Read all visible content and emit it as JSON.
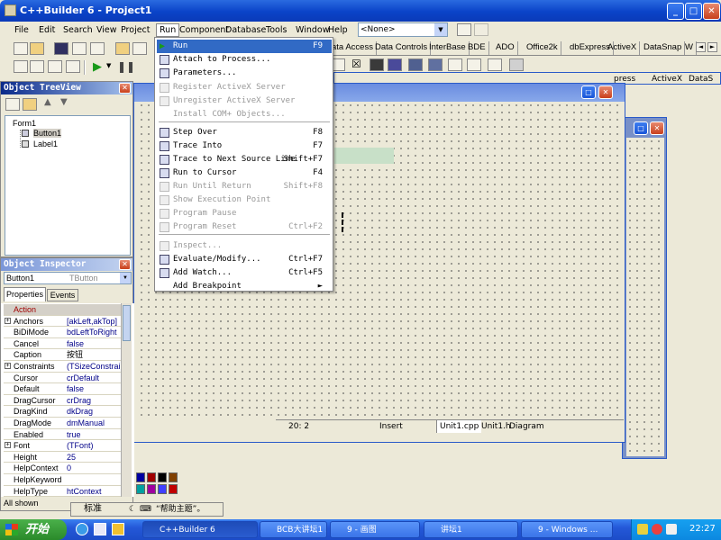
{
  "app": {
    "title": "C++Builder 6 - Project1"
  },
  "menu": [
    "File",
    "Edit",
    "Search",
    "View",
    "Project",
    "Run",
    "Component",
    "Database",
    "Tools",
    "Window",
    "Help"
  ],
  "combo": {
    "value": "<None>"
  },
  "palette_tabs": [
    "ata Access",
    "Data Controls",
    "InterBase",
    "BDE",
    "ADO",
    "Office2k",
    "dbExpress",
    "ActiveX",
    "DataSnap",
    "W"
  ],
  "palette_tabs2": [
    "press",
    "ActiveX",
    "DataS"
  ],
  "run_menu": [
    {
      "label": "Run",
      "shortcut": "F9",
      "state": "selected"
    },
    {
      "label": "Attach to Process...",
      "shortcut": "",
      "state": "enabled"
    },
    {
      "label": "Parameters...",
      "shortcut": "",
      "state": "enabled"
    },
    {
      "label": "Register ActiveX Server",
      "shortcut": "",
      "state": "disabled"
    },
    {
      "label": "Unregister ActiveX Server",
      "shortcut": "",
      "state": "disabled"
    },
    {
      "label": "Install COM+ Objects...",
      "shortcut": "",
      "state": "disabled"
    },
    {
      "label": "Step Over",
      "shortcut": "F8",
      "state": "enabled"
    },
    {
      "label": "Trace Into",
      "shortcut": "F7",
      "state": "enabled"
    },
    {
      "label": "Trace to Next Source Line",
      "shortcut": "Shift+F7",
      "state": "enabled"
    },
    {
      "label": "Run to Cursor",
      "shortcut": "F4",
      "state": "enabled"
    },
    {
      "label": "Run Until Return",
      "shortcut": "Shift+F8",
      "state": "disabled"
    },
    {
      "label": "Show Execution Point",
      "shortcut": "",
      "state": "disabled"
    },
    {
      "label": "Program Pause",
      "shortcut": "",
      "state": "disabled"
    },
    {
      "label": "Program Reset",
      "shortcut": "Ctrl+F2",
      "state": "disabled"
    },
    {
      "label": "Inspect...",
      "shortcut": "",
      "state": "disabled"
    },
    {
      "label": "Evaluate/Modify...",
      "shortcut": "Ctrl+F7",
      "state": "enabled"
    },
    {
      "label": "Add Watch...",
      "shortcut": "Ctrl+F5",
      "state": "enabled"
    },
    {
      "label": "Add Breakpoint",
      "shortcut": "►",
      "state": "enabled"
    }
  ],
  "treeview": {
    "title": "Object TreeView",
    "items": [
      "Form1",
      "Button1",
      "Label1"
    ]
  },
  "inspector": {
    "title": "Object Inspector",
    "object": "Button1",
    "type": "TButton",
    "tabs": [
      "Properties",
      "Events"
    ],
    "rows": [
      {
        "k": "Action",
        "v": "",
        "exp": false,
        "hl": true
      },
      {
        "k": "Anchors",
        "v": "[akLeft,akTop]",
        "exp": true
      },
      {
        "k": "BiDiMode",
        "v": "bdLeftToRight",
        "exp": false
      },
      {
        "k": "Cancel",
        "v": "false",
        "exp": false
      },
      {
        "k": "Caption",
        "v": "按钮",
        "exp": false,
        "sel": true
      },
      {
        "k": "Constraints",
        "v": "(TSizeConstrain",
        "exp": true
      },
      {
        "k": "Cursor",
        "v": "crDefault",
        "exp": false
      },
      {
        "k": "Default",
        "v": "false",
        "exp": false
      },
      {
        "k": "DragCursor",
        "v": "crDrag",
        "exp": false
      },
      {
        "k": "DragKind",
        "v": "dkDrag",
        "exp": false
      },
      {
        "k": "DragMode",
        "v": "dmManual",
        "exp": false
      },
      {
        "k": "Enabled",
        "v": "true",
        "exp": false
      },
      {
        "k": "Font",
        "v": "(TFont)",
        "exp": true
      },
      {
        "k": "Height",
        "v": "25",
        "exp": false
      },
      {
        "k": "HelpContext",
        "v": "0",
        "exp": false
      },
      {
        "k": "HelpKeyword",
        "v": "",
        "exp": false
      },
      {
        "k": "HelpType",
        "v": "htContext",
        "exp": false
      }
    ],
    "status": "All shown"
  },
  "editor_status": {
    "pos": "20:  2",
    "mode": "Insert",
    "tabs": [
      "Unit1.cpp",
      "Unit1.h",
      "Diagram"
    ]
  },
  "ime": {
    "mode": "标准",
    "hint": "“帮助主题”。"
  },
  "taskbar": {
    "start": "开始",
    "tasks": [
      "C++Builder 6",
      "BCB大讲坛1 ...",
      "9 - 画图",
      "讲坛1",
      "9 - Windows ..."
    ],
    "clock": "22:27"
  },
  "colors": {
    "palette": [
      "#0000a0",
      "#a00000",
      "#000000",
      "#804000",
      "#00a0a0",
      "#a000a0",
      "#4040ff",
      "#c00000"
    ]
  }
}
